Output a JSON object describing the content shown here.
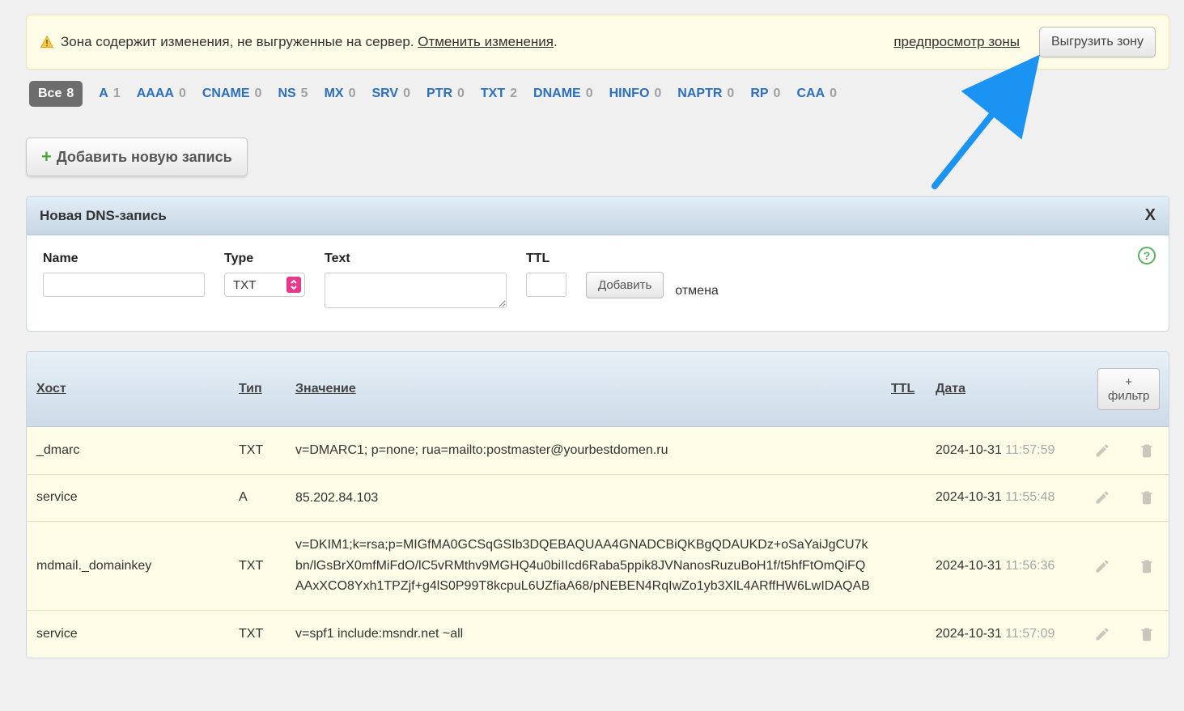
{
  "notice": {
    "text_prefix": "Зона содержит изменения, не выгруженные на сервер. ",
    "undo_link": "Отменить изменения",
    "suffix": ".",
    "preview_link": "предпросмотр зоны",
    "upload_button": "Выгрузить зону"
  },
  "tabs": {
    "all": {
      "label": "Все",
      "count": "8"
    },
    "items": [
      {
        "label": "A",
        "count": "1"
      },
      {
        "label": "AAAA",
        "count": "0"
      },
      {
        "label": "CNAME",
        "count": "0"
      },
      {
        "label": "NS",
        "count": "5"
      },
      {
        "label": "MX",
        "count": "0"
      },
      {
        "label": "SRV",
        "count": "0"
      },
      {
        "label": "PTR",
        "count": "0"
      },
      {
        "label": "TXT",
        "count": "2"
      },
      {
        "label": "DNAME",
        "count": "0"
      },
      {
        "label": "HINFO",
        "count": "0"
      },
      {
        "label": "NAPTR",
        "count": "0"
      },
      {
        "label": "RP",
        "count": "0"
      },
      {
        "label": "CAA",
        "count": "0"
      }
    ]
  },
  "add_button": "Добавить новую запись",
  "new_record": {
    "title": "Новая DNS-запись",
    "close": "X",
    "labels": {
      "name": "Name",
      "type": "Type",
      "text": "Text",
      "ttl": "TTL"
    },
    "type_value": "TXT",
    "submit": "Добавить",
    "cancel": "отмена",
    "help": "?"
  },
  "table": {
    "headers": {
      "host": "Хост",
      "type": "Тип",
      "value": "Значение",
      "ttl": "TTL",
      "date": "Дата"
    },
    "filter_button": "+ фильтр",
    "rows": [
      {
        "host": "_dmarc",
        "type": "TXT",
        "value": "v=DMARC1; p=none; rua=mailto:postmaster@yourbestdomen.ru",
        "ttl": "",
        "date": "2024-10-31",
        "time": "11:57:59"
      },
      {
        "host": "service",
        "type": "A",
        "value": "85.202.84.103",
        "ttl": "",
        "date": "2024-10-31",
        "time": "11:55:48"
      },
      {
        "host": "mdmail._domainkey",
        "type": "TXT",
        "value": "v=DKIM1;k=rsa;p=MIGfMA0GCSqGSIb3DQEBAQUAA4GNADCBiQKBgQDAUKDz+oSaYaiJgCU7kbn/lGsBrX0mfMiFdO/lC5vRMthv9MGHQ4u0biIIcd6Raba5ppik8JVNanosRuzuBoH1f/t5hfFtOmQiFQAAxXCO8Yxh1TPZjf+g4lS0P99T8kcpuL6UZfiaA68/pNEBEN4RqIwZo1yb3XlL4ARffHW6LwIDAQAB",
        "ttl": "",
        "date": "2024-10-31",
        "time": "11:56:36"
      },
      {
        "host": "service",
        "type": "TXT",
        "value": "v=spf1 include:msndr.net ~all",
        "ttl": "",
        "date": "2024-10-31",
        "time": "11:57:09"
      }
    ]
  }
}
